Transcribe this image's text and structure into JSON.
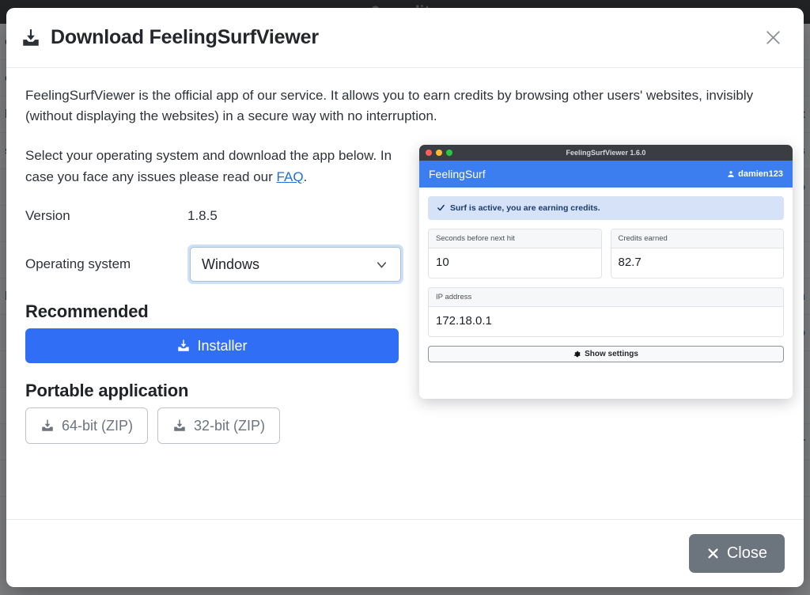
{
  "backdrop": {
    "topbar_text": "0 credits",
    "rows": [
      {
        "left": "c",
        "right": ""
      },
      {
        "left": "o",
        "right": ""
      },
      {
        "left": "l",
        "right": "t"
      },
      {
        "left": "s",
        "right": "s"
      },
      {
        "left": "",
        "right": "o"
      },
      {
        "left": "",
        "right": ""
      },
      {
        "left": "",
        "right": ""
      },
      {
        "left": "l",
        "right": "n"
      },
      {
        "left": "",
        "right": "o"
      },
      {
        "left": "",
        "right": ""
      },
      {
        "left": "",
        "right": ""
      },
      {
        "left": "",
        "right": "r"
      },
      {
        "left": "",
        "right": ""
      }
    ]
  },
  "modal": {
    "title": "Download FeelingSurfViewer",
    "title_icon": "download-icon",
    "close_icon": "close-icon",
    "intro": "FeelingSurfViewer is the official app of our service. It allows you to earn credits by browsing other users' websites, invisibly (without displaying the websites) in a secure way with no interruption.",
    "select_help_prefix": "Select your operating system and download the app below. In case you face any issues please read our ",
    "faq_link_label": "FAQ",
    "select_help_suffix": ".",
    "version_label": "Version",
    "version_value": "1.8.5",
    "os_label": "Operating system",
    "os_value": "Windows",
    "os_caret_icon": "chevron-down-icon",
    "recommended_heading": "Recommended",
    "installer_label": "Installer",
    "installer_icon": "download-icon",
    "installer_color": "#2f6ef5",
    "portable_heading": "Portable application",
    "portable_buttons": [
      {
        "label": "64-bit (ZIP)",
        "icon": "download-icon"
      },
      {
        "label": "32-bit (ZIP)",
        "icon": "download-icon"
      }
    ],
    "footer": {
      "close_label": "Close",
      "close_icon": "close-x-icon",
      "close_color": "#6c757d"
    }
  },
  "app_preview": {
    "window_title": "FeelingSurfViewer 1.6.0",
    "traffic_lights": [
      "#ff5f57",
      "#febc2e",
      "#28c840"
    ],
    "brand": "FeelingSurf",
    "user": "damien123",
    "user_icon": "user-icon",
    "navbar_color": "#3c7ef0",
    "alert_text": "Surf is active, you are earning credits.",
    "alert_icon": "check-icon",
    "cards": [
      {
        "label": "Seconds before next hit",
        "value": "10"
      },
      {
        "label": "Credits earned",
        "value": "82.7"
      },
      {
        "label": "IP address",
        "value": "172.18.0.1"
      }
    ],
    "settings_button_label": "Show settings",
    "settings_button_icon": "gear-icon"
  }
}
